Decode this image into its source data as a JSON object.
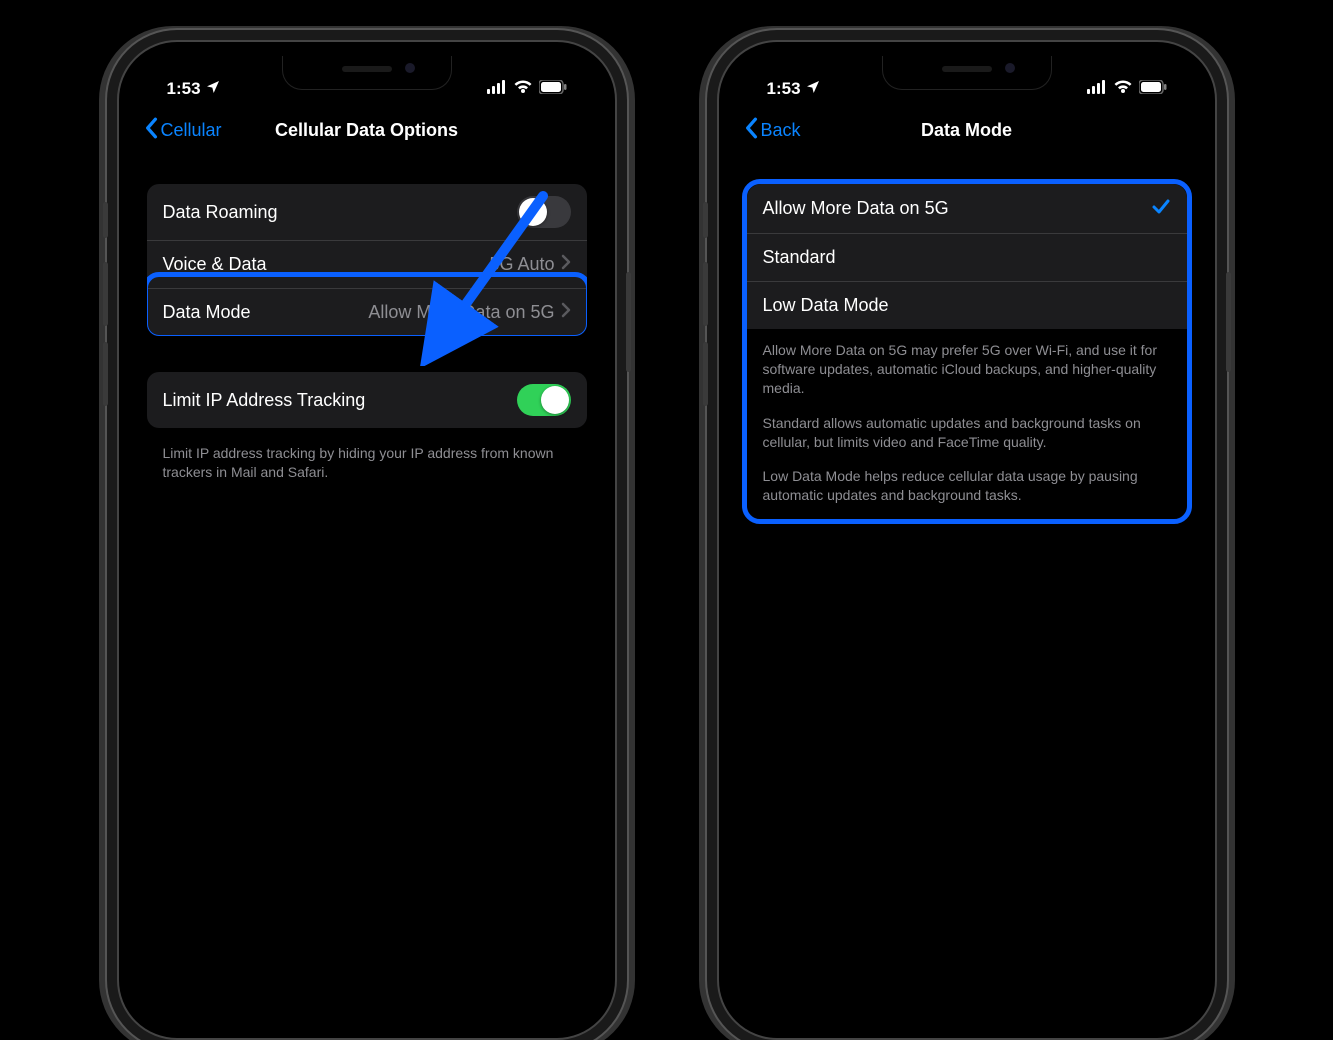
{
  "status": {
    "time": "1:53"
  },
  "phone1": {
    "back_label": "Cellular",
    "title": "Cellular Data Options",
    "group1": {
      "row1": {
        "label": "Data Roaming"
      },
      "row2": {
        "label": "Voice & Data",
        "value": "5G Auto"
      },
      "row3": {
        "label": "Data Mode",
        "value": "Allow More Data on 5G"
      }
    },
    "group2": {
      "row1": {
        "label": "Limit IP Address Tracking"
      },
      "footer": "Limit IP address tracking by hiding your IP address from known trackers in Mail and Safari."
    }
  },
  "phone2": {
    "back_label": "Back",
    "title": "Data Mode",
    "options": {
      "opt1": "Allow More Data on 5G",
      "opt2": "Standard",
      "opt3": "Low Data Mode"
    },
    "desc": {
      "p1": "Allow More Data on 5G may prefer 5G over Wi-Fi, and use it for software updates, automatic iCloud backups, and higher-quality media.",
      "p2": "Standard allows automatic updates and background tasks on cellular, but limits video and FaceTime quality.",
      "p3": "Low Data Mode helps reduce cellular data usage by pausing automatic updates and background tasks."
    }
  }
}
